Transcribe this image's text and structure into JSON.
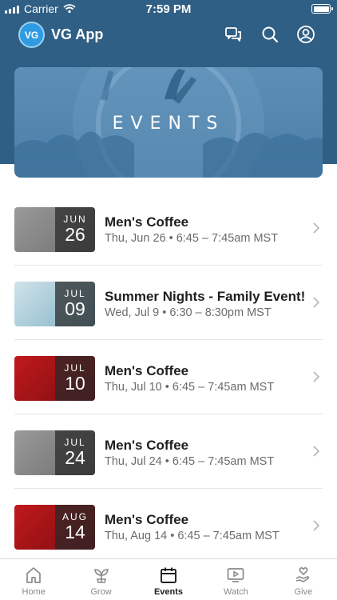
{
  "status_bar": {
    "carrier": "Carrier",
    "time": "7:59 PM"
  },
  "header": {
    "logo_text": "VG",
    "title": "VG App"
  },
  "banner": {
    "title": "EVENTS"
  },
  "events": [
    {
      "title": "Men's Coffee",
      "subtitle": "Thu, Jun 26 • 6:45 – 7:45am MST",
      "month": "JUN",
      "day": "26",
      "thumb": "coffee-grey"
    },
    {
      "title": "Summer Nights - Family Event!",
      "subtitle": "Wed, Jul 9 • 6:30 – 8:30pm MST",
      "month": "JUL",
      "day": "09",
      "thumb": "summer"
    },
    {
      "title": "Men's Coffee",
      "subtitle": "Thu, Jul 10 • 6:45 – 7:45am MST",
      "month": "JUL",
      "day": "10",
      "thumb": "coffee-red"
    },
    {
      "title": "Men's Coffee",
      "subtitle": "Thu, Jul 24 • 6:45 – 7:45am MST",
      "month": "JUL",
      "day": "24",
      "thumb": "coffee-grey"
    },
    {
      "title": "Men's Coffee",
      "subtitle": "Thu, Aug 14 • 6:45 – 7:45am MST",
      "month": "AUG",
      "day": "14",
      "thumb": "coffee-red"
    }
  ],
  "tabs": [
    {
      "label": "Home",
      "icon": "home-icon",
      "active": false
    },
    {
      "label": "Grow",
      "icon": "grow-icon",
      "active": false
    },
    {
      "label": "Events",
      "icon": "calendar-icon",
      "active": true
    },
    {
      "label": "Watch",
      "icon": "watch-icon",
      "active": false
    },
    {
      "label": "Give",
      "icon": "give-icon",
      "active": false
    }
  ],
  "colors": {
    "header_bg": "#2f5f84",
    "accent": "#2f9be3",
    "active_tab": "#1f1f1f",
    "inactive_tab": "#8a8a8a"
  }
}
